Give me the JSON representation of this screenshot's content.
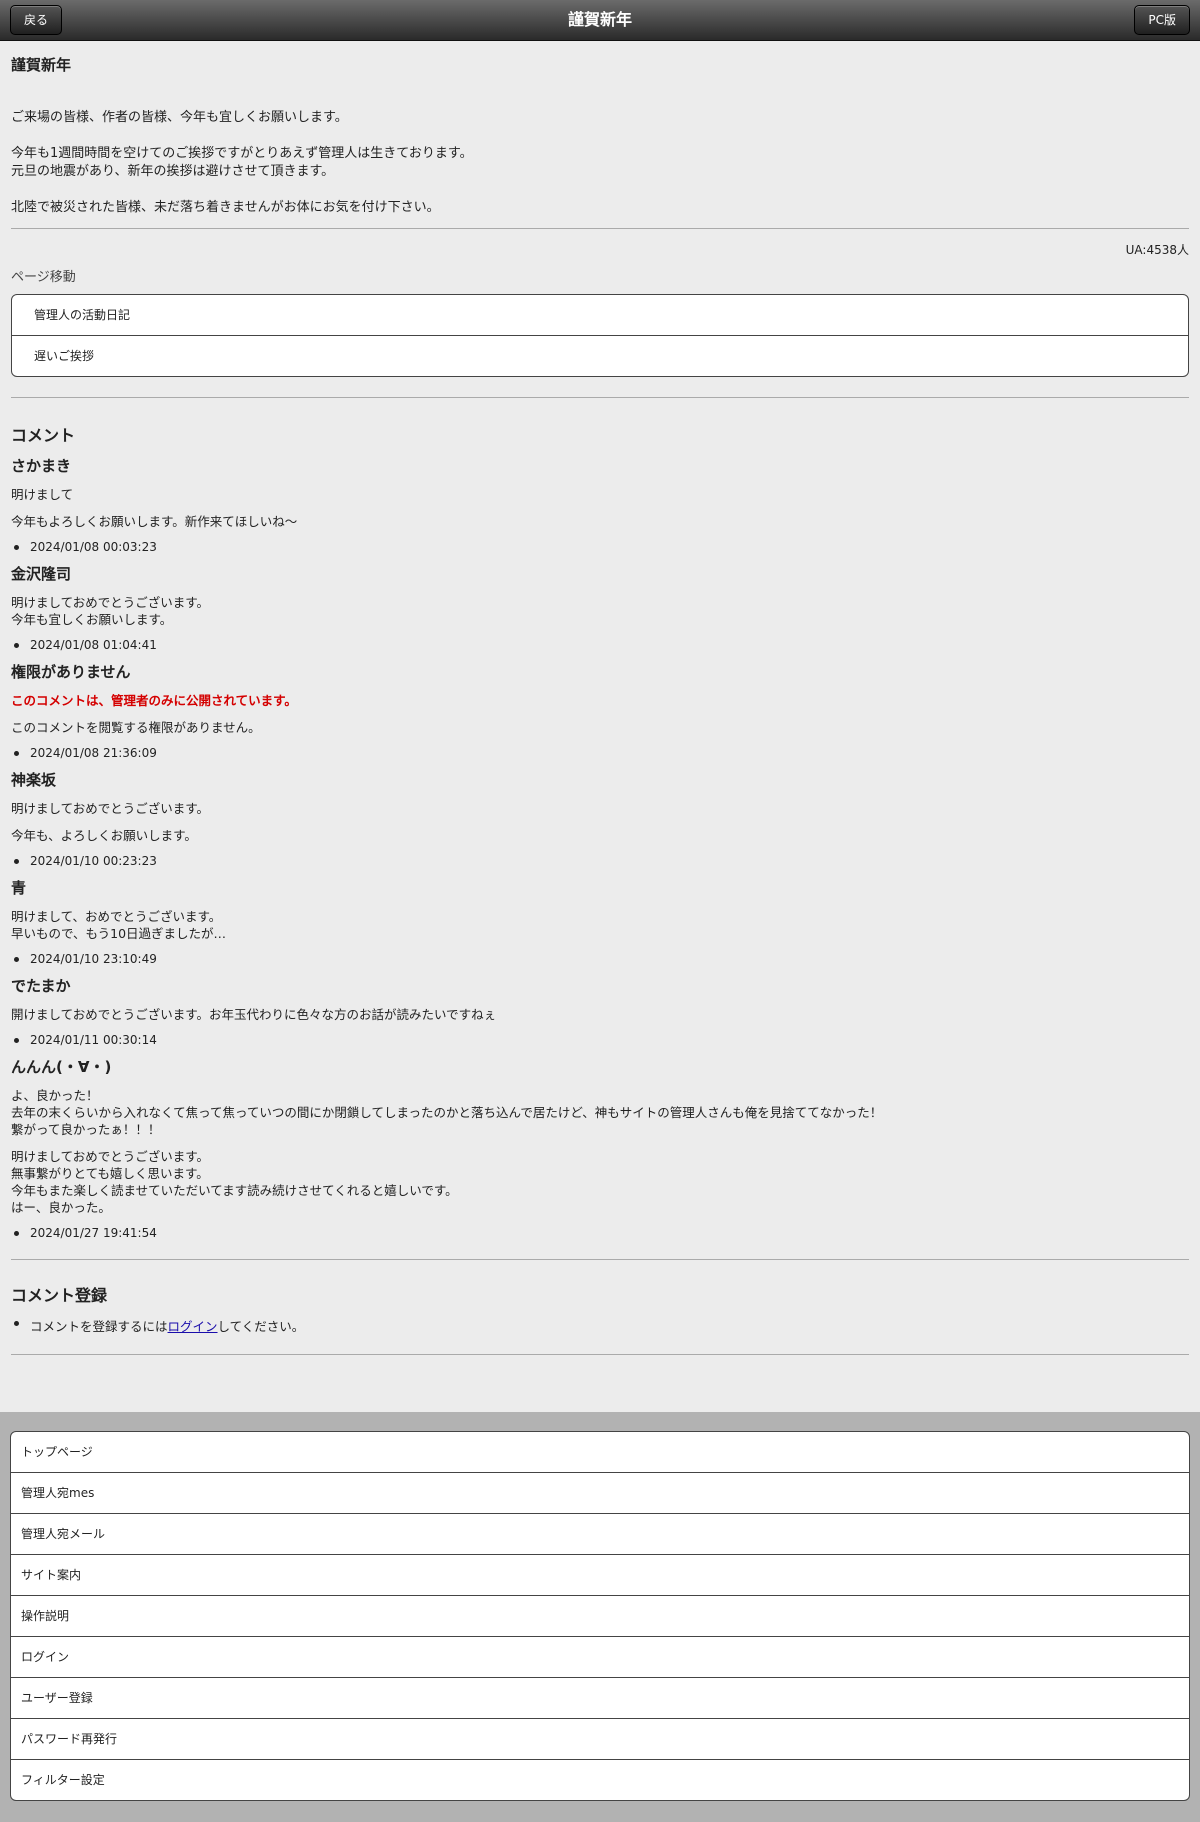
{
  "header": {
    "back_label": "戻る",
    "title": "謹賀新年",
    "pc_label": "PC版"
  },
  "article": {
    "title": "謹賀新年",
    "paragraphs": [
      [
        "ご来場の皆様、作者の皆様、今年も宜しくお願いします。"
      ],
      [
        "今年も1週間時間を空けてのご挨拶ですがとりあえず管理人は生きております。",
        "元旦の地震があり、新年の挨拶は避けさせて頂きます。"
      ],
      [
        "北陸で被災された皆様、未だ落ち着きませんがお体にお気を付け下さい。"
      ]
    ]
  },
  "ua_count": "UA:4538人",
  "page_move": {
    "label": "ページ移動",
    "items": [
      "管理人の活動日記",
      "遅いご挨拶"
    ]
  },
  "comments_title": "コメント",
  "comments": [
    {
      "author": "さかまき",
      "paragraphs": [
        [
          "明けまして"
        ],
        [
          "今年もよろしくお願いします。新作来てほしいね〜"
        ]
      ],
      "date": "2024/01/08 00:03:23"
    },
    {
      "author": "金沢隆司",
      "paragraphs": [
        [
          "明けましておめでとうございます。",
          "今年も宜しくお願いします。"
        ]
      ],
      "date": "2024/01/08 01:04:41"
    },
    {
      "author": "権限がありません",
      "notice": "このコメントは、管理者のみに公開されています。",
      "paragraphs": [
        [
          "このコメントを閲覧する権限がありません。"
        ]
      ],
      "date": "2024/01/08 21:36:09"
    },
    {
      "author": "神楽坂",
      "paragraphs": [
        [
          "明けましておめでとうございます。"
        ],
        [
          "今年も、よろしくお願いします。"
        ]
      ],
      "date": "2024/01/10 00:23:23"
    },
    {
      "author": "青",
      "paragraphs": [
        [
          "明けまして、おめでとうございます。",
          "早いもので、もう10日過ぎましたが…"
        ]
      ],
      "date": "2024/01/10 23:10:49"
    },
    {
      "author": "でたまか",
      "paragraphs": [
        [
          "開けましておめでとうございます。お年玉代わりに色々な方のお話が読みたいですねぇ"
        ]
      ],
      "date": "2024/01/11 00:30:14"
    },
    {
      "author": "んんん(・∀・)",
      "paragraphs": [
        [
          "よ、良かった！",
          "去年の末くらいから入れなくて焦って焦っていつの間にか閉鎖してしまったのかと落ち込んで居たけど、神もサイトの管理人さんも俺を見捨ててなかった！",
          "繋がって良かったぁ！！！"
        ],
        [
          "明けましておめでとうございます。",
          "無事繋がりとても嬉しく思います。",
          "今年もまた楽しく読ませていただいてます読み続けさせてくれると嬉しいです。",
          "はー、良かった。"
        ]
      ],
      "date": "2024/01/27 19:41:54"
    }
  ],
  "register": {
    "title": "コメント登録",
    "prefix": "コメントを登録するには",
    "link": "ログイン",
    "suffix": "してください。"
  },
  "footer_menu": [
    "トップページ",
    "管理人宛mes",
    "管理人宛メール",
    "サイト案内",
    "操作説明",
    "ログイン",
    "ユーザー登録",
    "パスワード再発行",
    "フィルター設定"
  ]
}
